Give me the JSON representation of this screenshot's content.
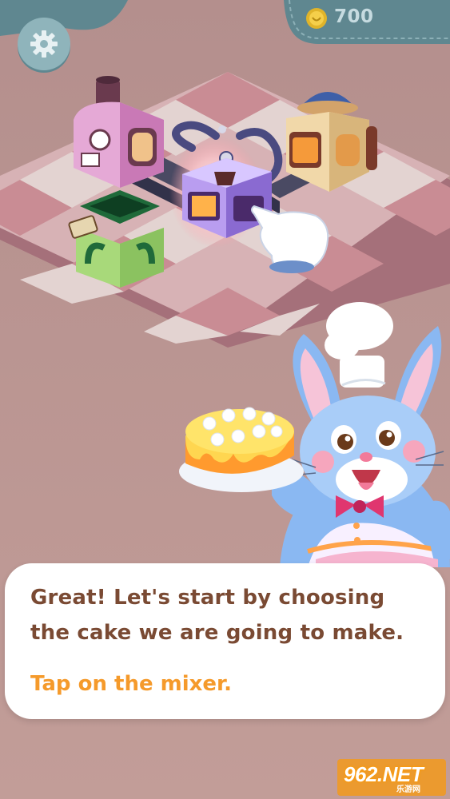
{
  "hud": {
    "coins": "700",
    "settings_icon": "gear-icon",
    "coin_icon": "coin-icon"
  },
  "machines": [
    {
      "name": "oven-machine"
    },
    {
      "name": "mixer-machine"
    },
    {
      "name": "decorator-machine"
    },
    {
      "name": "cashier-machine"
    }
  ],
  "tutorial": {
    "line1": "Great! Let's start by choosing",
    "line2": "the cake we are going to make.",
    "hint": "Tap on the mixer.",
    "pointer_icon": "pointing-hand-icon"
  },
  "watermark": {
    "text": "962.NET",
    "sub": "乐游网"
  },
  "colors": {
    "background": "#b89590",
    "dialog_text": "#7a4a33",
    "hint_text": "#f59a2b",
    "tile_pink": "#c98c94",
    "tile_light": "#e3d3d1"
  }
}
